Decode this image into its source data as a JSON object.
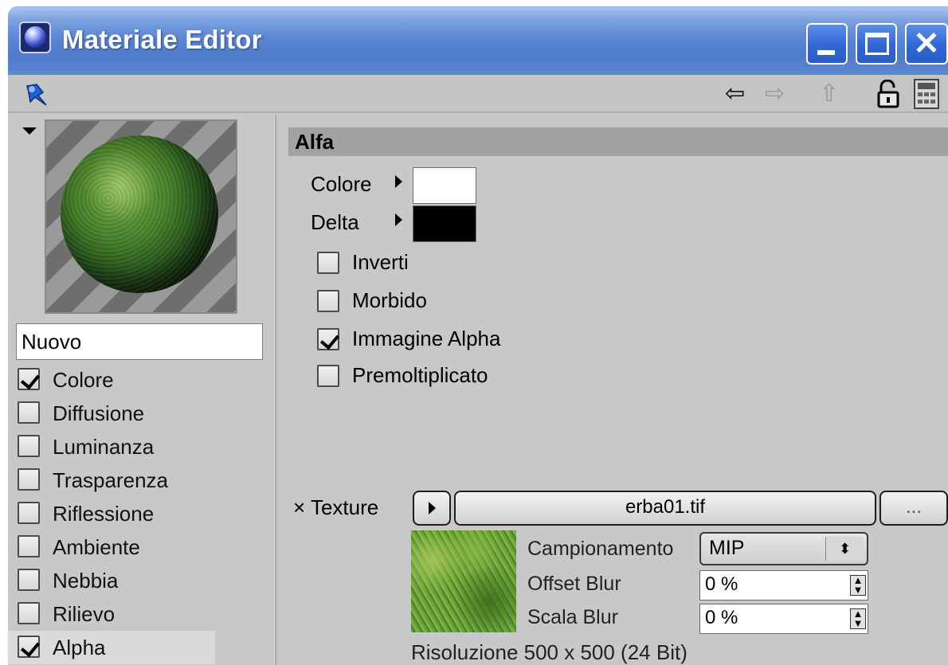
{
  "window": {
    "title": "Materiale Editor",
    "controls": [
      "minimize",
      "maximize",
      "close"
    ]
  },
  "toolbar": {
    "icons": [
      "pin-icon",
      "back-arrow-icon",
      "forward-arrow-icon",
      "up-arrow-icon",
      "lock-icon",
      "calculator-icon"
    ]
  },
  "material": {
    "name": "Nuovo",
    "channels": [
      {
        "label": "Colore",
        "checked": true
      },
      {
        "label": "Diffusione",
        "checked": false
      },
      {
        "label": "Luminanza",
        "checked": false
      },
      {
        "label": "Trasparenza",
        "checked": false
      },
      {
        "label": "Riflessione",
        "checked": false
      },
      {
        "label": "Ambiente",
        "checked": false
      },
      {
        "label": "Nebbia",
        "checked": false
      },
      {
        "label": "Rilievo",
        "checked": false
      },
      {
        "label": "Alpha",
        "checked": true,
        "selected": true
      }
    ]
  },
  "alpha": {
    "header": "Alfa",
    "color_label": "Colore",
    "color_value": "#ffffff",
    "delta_label": "Delta",
    "delta_value": "#000000",
    "options": [
      {
        "label": "Inverti",
        "checked": false
      },
      {
        "label": "Morbido",
        "checked": false
      },
      {
        "label": "Immagine Alpha",
        "checked": true
      },
      {
        "label": "Premoltiplicato",
        "checked": false
      }
    ],
    "texture_label": "× Texture",
    "texture_file": "erba01.tif",
    "texture_more": "...",
    "sampling_label": "Campionamento",
    "sampling_value": "MIP",
    "offset_blur_label": "Offset Blur",
    "offset_blur_value": "0 %",
    "scale_blur_label": "Scala Blur",
    "scale_blur_value": "0 %",
    "resolution": "Risoluzione 500 x 500  (24 Bit)"
  }
}
